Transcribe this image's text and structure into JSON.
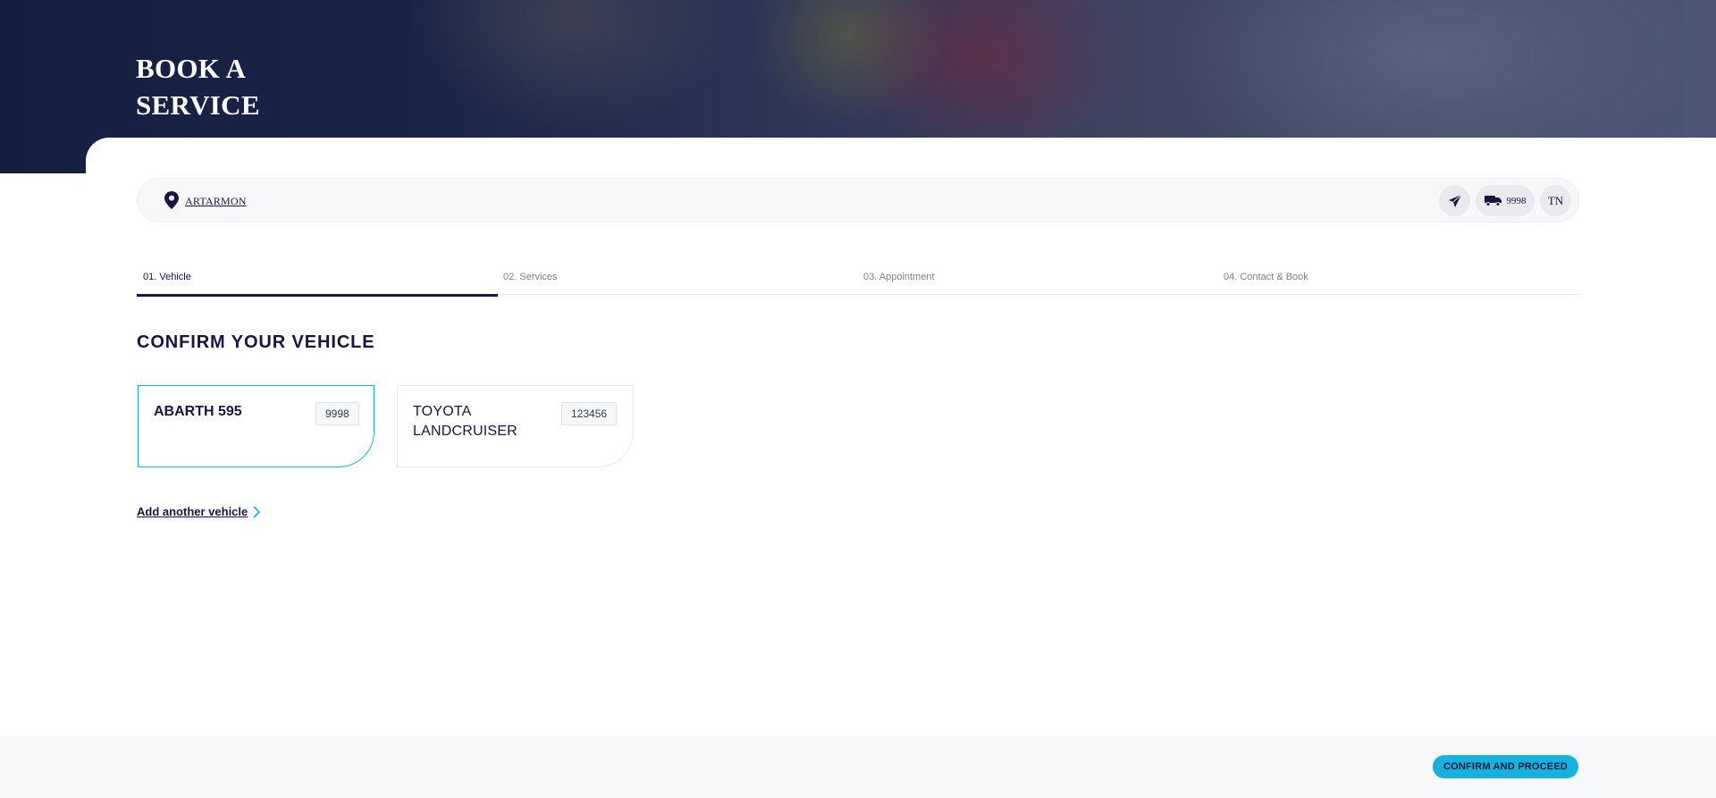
{
  "hero": {
    "title": "BOOK A SERVICE"
  },
  "location_bar": {
    "location_label": "ARTARMON",
    "vehicle_count": "9998",
    "user_initials": "TN",
    "icons": [
      "location-pin-icon",
      "send-icon",
      "truck-icon"
    ]
  },
  "steps": [
    {
      "label": "01. Vehicle",
      "active": true
    },
    {
      "label": "02. Services",
      "active": false
    },
    {
      "label": "03. Appointment",
      "active": false
    },
    {
      "label": "04. Contact & Book",
      "active": false
    }
  ],
  "main": {
    "title": "CONFIRM YOUR VEHICLE",
    "vehicles": [
      {
        "name": "ABARTH 595",
        "rego": "9998",
        "selected": true
      },
      {
        "name": "TOYOTA LANDCRUISER",
        "rego": "123456",
        "selected": false
      }
    ],
    "add_vehicle_label": "Add another vehicle"
  },
  "footer": {
    "confirm_label": "CONFIRM AND PROCEED"
  },
  "colors": {
    "navy": "#1a1446",
    "accent": "#14b2de"
  }
}
